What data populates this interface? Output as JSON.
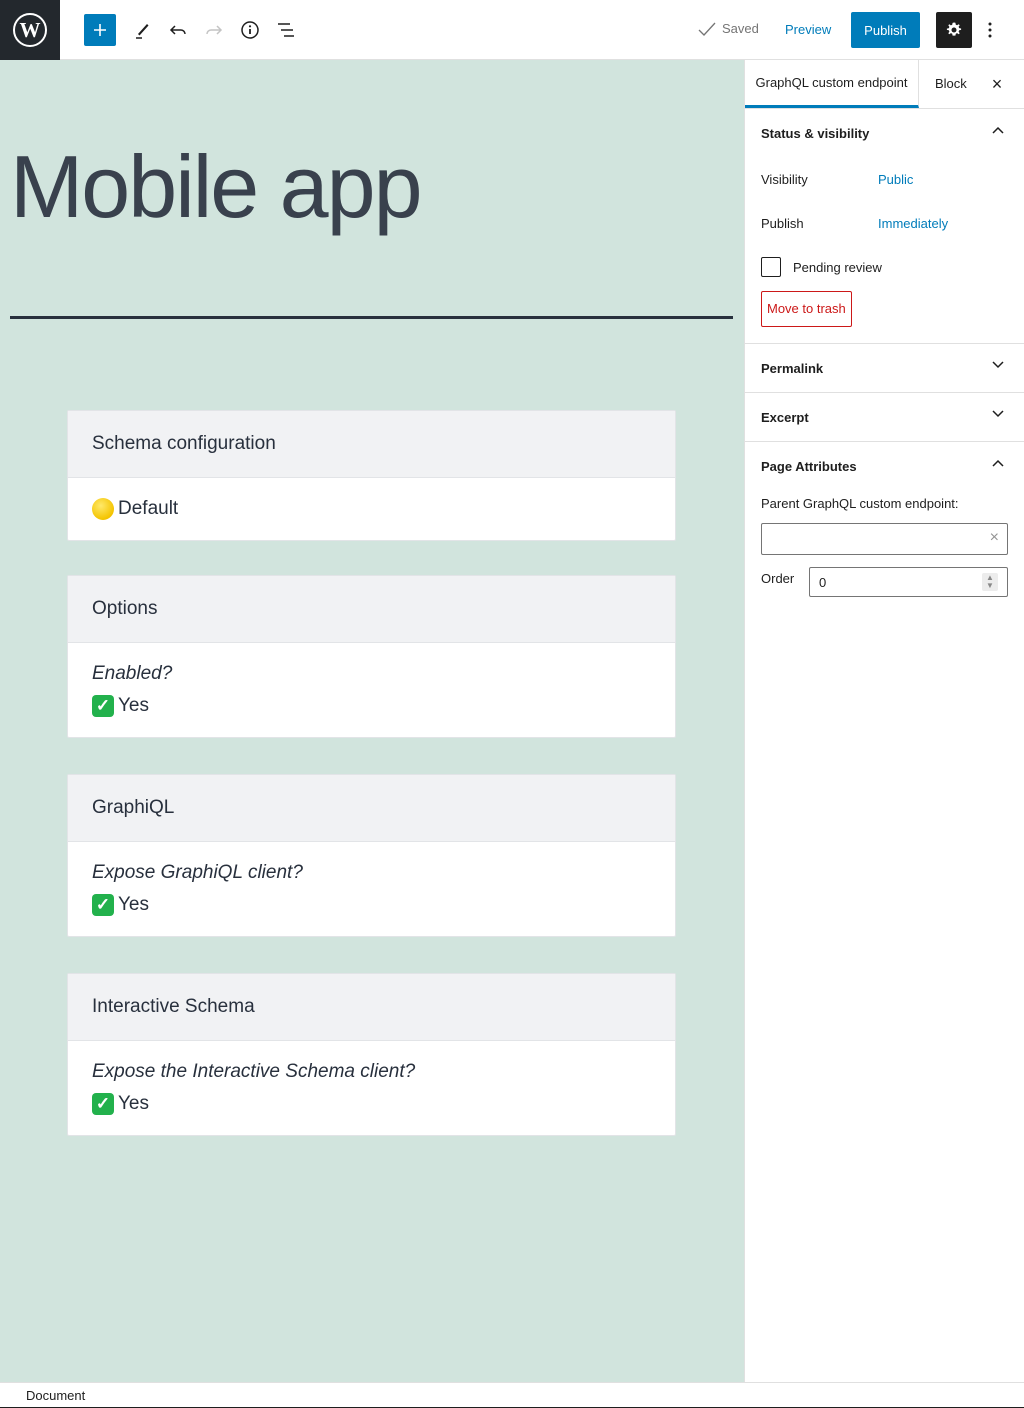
{
  "toolbar": {
    "logo": "wordpress-logo",
    "icons": [
      "plus-icon",
      "pencil-icon",
      "undo-icon",
      "redo-icon",
      "info-icon",
      "list-view-icon"
    ],
    "saved_label": "Saved",
    "preview_label": "Preview",
    "publish_label": "Publish",
    "accent": "#007cba"
  },
  "editor": {
    "title": "Mobile app",
    "background": "#d1e4dd",
    "cards": [
      {
        "header": "Schema configuration",
        "question": "",
        "emoji": "yellow-circle",
        "answer": "Default"
      },
      {
        "header": "Options",
        "question": "Enabled?",
        "emoji": "check-mark",
        "answer": "Yes"
      },
      {
        "header": "GraphiQL",
        "question": "Expose GraphiQL client?",
        "emoji": "check-mark",
        "answer": "Yes"
      },
      {
        "header": "Interactive Schema",
        "question": "Expose the Interactive Schema client?",
        "emoji": "check-mark",
        "answer": "Yes"
      }
    ]
  },
  "sidebar": {
    "tabs": {
      "document": "GraphQL custom endpoint",
      "block": "Block"
    },
    "status": {
      "title": "Status & visibility",
      "visibility_label": "Visibility",
      "visibility_value": "Public",
      "publish_label": "Publish",
      "publish_value": "Immediately",
      "pending_label": "Pending review",
      "pending_checked": false,
      "trash_label": "Move to trash"
    },
    "permalink": "Permalink",
    "excerpt": "Excerpt",
    "page_attributes": {
      "title": "Page Attributes",
      "parent_label": "Parent GraphQL custom endpoint:",
      "parent_value": "",
      "order_label": "Order",
      "order_value": "0"
    }
  },
  "footer": {
    "breadcrumb": "Document"
  }
}
